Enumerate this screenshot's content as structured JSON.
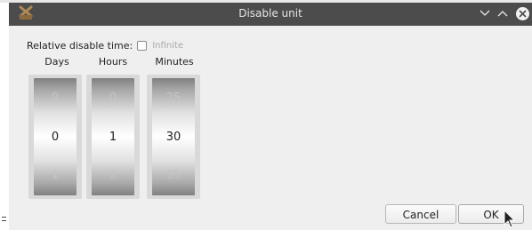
{
  "window": {
    "title": "Disable unit",
    "icons": {
      "app": "app-icon",
      "minimize": "chevron-down-icon",
      "maximize": "chevron-up-icon",
      "close": "close-icon"
    }
  },
  "form": {
    "relative_label": "Relative disable time:",
    "infinite_label": "Infinite",
    "infinite_checked": false
  },
  "spinners": {
    "days": {
      "label": "Days",
      "prev": "9",
      "value": "0",
      "next": "1"
    },
    "hours": {
      "label": "Hours",
      "prev": "0",
      "value": "1",
      "next": "2"
    },
    "minutes": {
      "label": "Minutes",
      "prev": "25",
      "value": "30",
      "next": "35"
    }
  },
  "buttons": {
    "cancel": "Cancel",
    "ok": "OK"
  },
  "colors": {
    "titlebar": "#4c4c4c",
    "dialog_bg": "#efefef"
  }
}
